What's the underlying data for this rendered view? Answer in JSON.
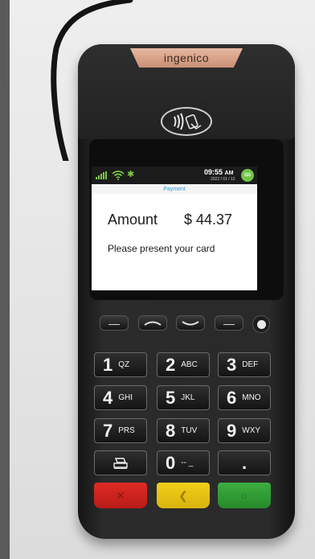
{
  "device": {
    "brand": "ingenico"
  },
  "screen": {
    "time": "09:55",
    "ampm": "AM",
    "date": "2022 / 01 / 12",
    "app_badge": "$$$",
    "title": "Payment",
    "amount_label": "Amount",
    "amount_value": "$ 44.37",
    "prompt": "Please present your card"
  },
  "keypad": {
    "row1": [
      {
        "num": "1",
        "letters": "QZ"
      },
      {
        "num": "2",
        "letters": "ABC"
      },
      {
        "num": "3",
        "letters": "DEF"
      }
    ],
    "row2": [
      {
        "num": "4",
        "letters": "GHI"
      },
      {
        "num": "5",
        "letters": "JKL"
      },
      {
        "num": "6",
        "letters": "MNO"
      }
    ],
    "row3": [
      {
        "num": "7",
        "letters": "PRS"
      },
      {
        "num": "8",
        "letters": "TUV"
      },
      {
        "num": "9",
        "letters": "WXY"
      }
    ],
    "row4": [
      {
        "num": "",
        "letters": ""
      },
      {
        "num": "0",
        "letters": "-- _"
      },
      {
        "num": ".",
        "letters": ""
      }
    ]
  },
  "colors": {
    "cancel": "#d42520",
    "clear": "#e8c412",
    "ok": "#33a036",
    "bluetooth": "#7cc843",
    "title": "#2e9fe0"
  }
}
